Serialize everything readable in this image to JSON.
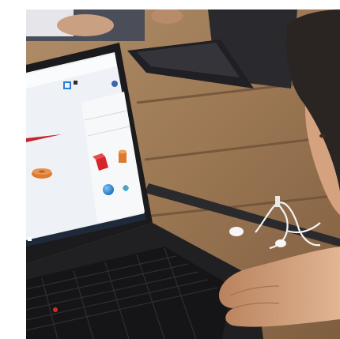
{
  "scene": {
    "subject": "child-using-laptop-with-3d-design-app",
    "visible_text": []
  },
  "palette": {
    "table_wood": "#9c7a58",
    "table_shadow": "#5d4632",
    "laptop_body": "#1b1b1d",
    "screen_bg": "#f1f3f6",
    "accent_blue": "#2f7fd1",
    "shape_red": "#d3252a",
    "shape_orange": "#dd7a2e",
    "skin": "#d5a27f",
    "hair": "#2a2422",
    "earphones": "#f4f4f4"
  },
  "icons": [
    "cube-shape-icon",
    "cylinder-shape-icon",
    "sphere-shape-icon",
    "torus-shape-icon"
  ]
}
